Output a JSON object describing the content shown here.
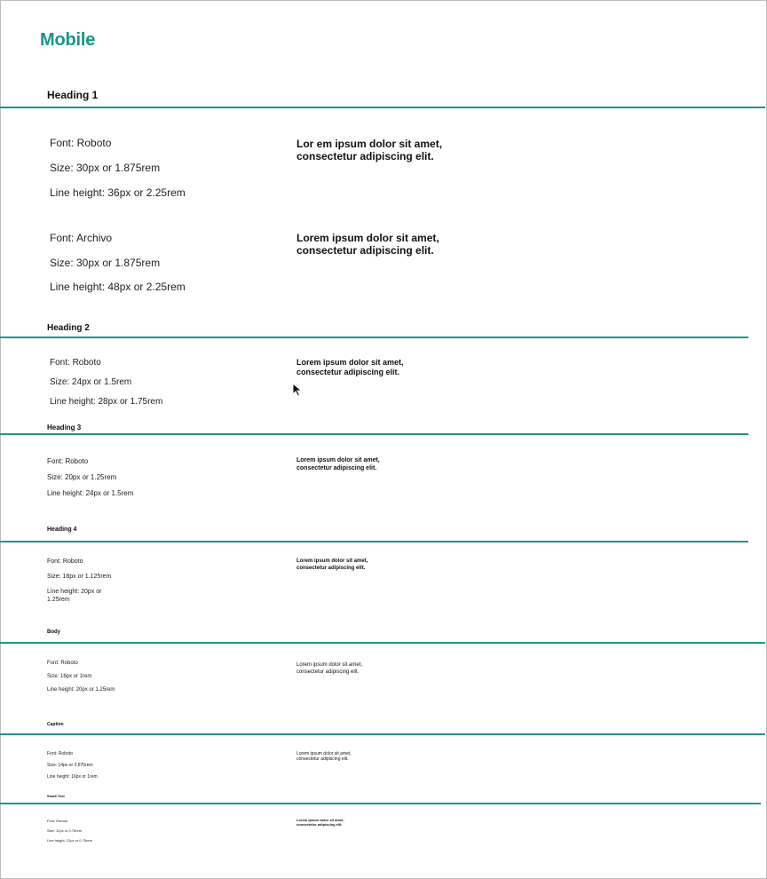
{
  "page_title": "Mobile",
  "accent_color": "#1f978b",
  "sections": {
    "h1": {
      "label": "Heading 1",
      "roboto": {
        "font": "Font: Roboto",
        "size": "Size: 30px or 1.875rem",
        "line": "Line height: 36px or 2.25rem",
        "sample": "Lor em ipsum dolor sit amet, consectetur adipiscing elit."
      },
      "archivo": {
        "font": "Font: Archivo",
        "size": "Size: 30px or 1.875rem",
        "line": "Line height: 48px or 2.25rem",
        "sample": "Lorem ipsum dolor sit amet, consectetur adipiscing elit."
      }
    },
    "h2": {
      "label": "Heading 2",
      "font": "Font: Roboto",
      "size": "Size: 24px or 1.5rem",
      "line": "Line height: 28px or 1.75rem",
      "sample": "Lorem ipsum dolor sit amet, consectetur adipiscing elit."
    },
    "h3": {
      "label": "Heading 3",
      "font": "Font: Roboto",
      "size": "Size: 20px or 1.25rem",
      "line": "Line height: 24px or 1.5rem",
      "sample": "Lorem ipsum dolor sit amet, consectetur adipiscing elit."
    },
    "h4": {
      "label": "Heading 4",
      "font": "Font: Roboto",
      "size": "Size: 18px or 1.125rem",
      "line": "Line height: 20px or 1.25rem",
      "sample": "Lorem ipsum dolor sit amet, consectetur adipiscing elit."
    },
    "body": {
      "label": "Body",
      "font": "Font: Roboto",
      "size": "Size: 16px or 1rem",
      "line": "Line height: 20px or 1.25rem",
      "sample": "Lorem ipsum dolor sit amet, consectetur adipiscing elit."
    },
    "caption": {
      "label": "Caption",
      "font": "Font: Roboto",
      "size": "Size: 14px or 0.875rem",
      "line": "Line height: 16px or 1rem",
      "sample": "Lorem ipsum dolor sit amet, consectetur adipiscing elit."
    },
    "small": {
      "label": "Small Text",
      "font": "Font: Roboto",
      "size": "Size: 12px or 0.75rem",
      "line": "Line height: 12px or 0.75rem",
      "sample": "Lorem ipsum dolor sit amet, consectetur adipiscing elit."
    }
  },
  "cursor_icon": "mouse-pointer-icon"
}
